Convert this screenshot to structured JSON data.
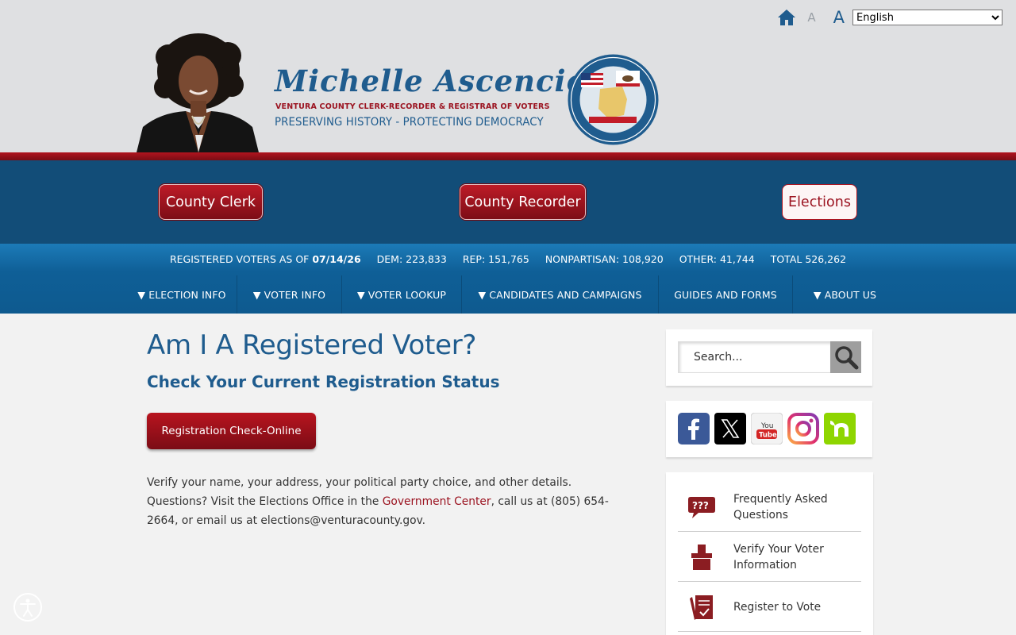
{
  "topbar": {
    "font_small_label": "A",
    "font_large_label": "A",
    "language_selected": "English"
  },
  "brand": {
    "name": "Michelle Ascencion",
    "title": "VENTURA COUNTY CLERK-RECORDER & REGISTRAR OF VOTERS",
    "motto": "PRESERVING HISTORY - PROTECTING DEMOCRACY"
  },
  "departments": [
    {
      "label": "County Clerk"
    },
    {
      "label": "County Recorder"
    },
    {
      "label": "Elections"
    }
  ],
  "stats": {
    "registered_label": "REGISTERED VOTERS AS OF",
    "date": "07/14/26",
    "dem_label": "DEM",
    "dem_value": "223,833",
    "rep_label": "REP",
    "rep_value": "151,765",
    "nonpartisan_label": "NONPARTISAN",
    "nonpartisan_value": "108,920",
    "other_label": "OTHER",
    "other_value": "41,744",
    "total_label": "TOTAL",
    "total_value": "526,262"
  },
  "nav": [
    {
      "label": "▼ ELECTION INFO"
    },
    {
      "label": "▼ VOTER INFO"
    },
    {
      "label": "▼ VOTER LOOKUP"
    },
    {
      "label": "▼ CANDIDATES AND CAMPAIGNS"
    },
    {
      "label": "GUIDES AND FORMS"
    },
    {
      "label": "▼ ABOUT US"
    }
  ],
  "main": {
    "title": "Am I A Registered Voter?",
    "subtitle": "Check Your Current Registration Status",
    "cta_label": "Registration Check-Online",
    "text_before_link": "Verify your name, your address, your political party choice, and other details. Questions? Visit the Elections Office in the ",
    "link_text": "Government Center",
    "text_after_link": ", call us at (805) 654-2664, or email us at elections@venturacounty.gov."
  },
  "sidebar": {
    "search_placeholder": "Search...",
    "social": [
      {
        "icon": "facebook-icon",
        "color": "#3b5998"
      },
      {
        "icon": "x-twitter-icon",
        "color": "#000000"
      },
      {
        "icon": "youtube-icon",
        "color": "#d32626"
      },
      {
        "icon": "instagram-icon",
        "color": "#c13584"
      },
      {
        "icon": "nextdoor-icon",
        "color": "#8ed500"
      }
    ],
    "quick_links": [
      {
        "label": "Frequently Asked Questions",
        "icon": "faq-speech-bubble-icon"
      },
      {
        "label": "Verify Your Voter Information",
        "icon": "ballot-box-icon"
      },
      {
        "label": "Register to Vote",
        "icon": "register-form-icon"
      }
    ]
  },
  "colors": {
    "brand_blue": "#1f5c8e",
    "brand_red": "#9b1320",
    "nav_blue": "#124d78"
  }
}
